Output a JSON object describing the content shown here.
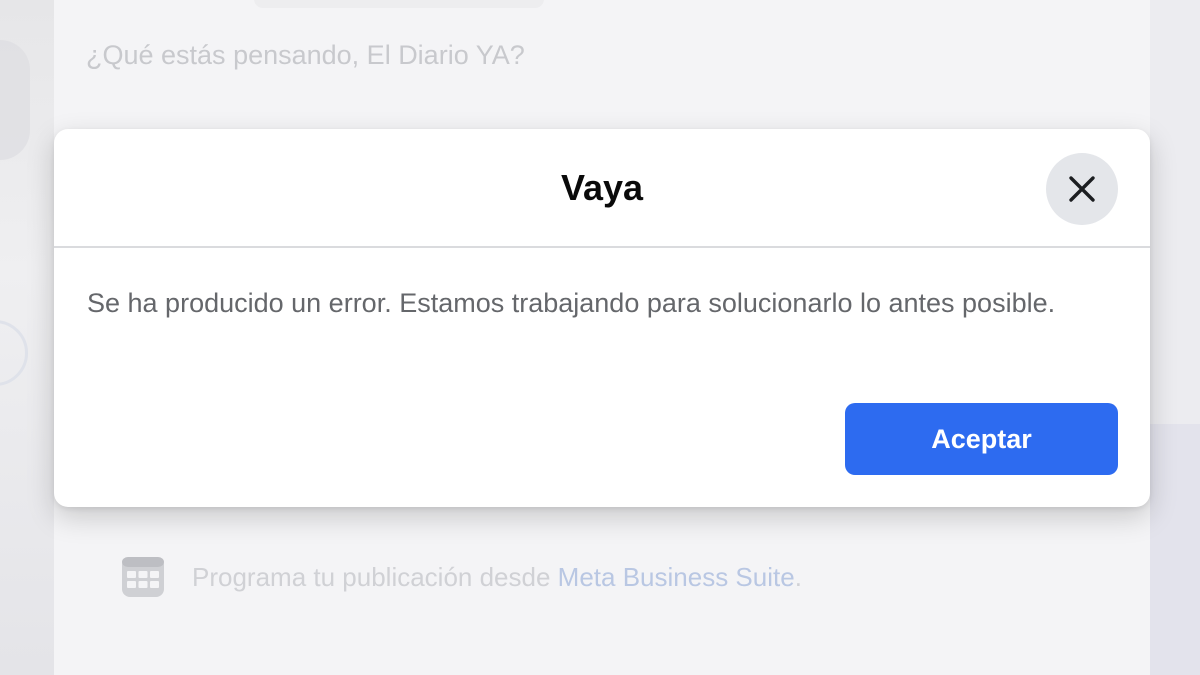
{
  "background": {
    "composer_placeholder": "¿Qué estás pensando, El Diario YA?",
    "schedule": {
      "icon": "calendar-icon",
      "text": "Programa tu publicación desde ",
      "link": "Meta Business Suite",
      "suffix": "."
    }
  },
  "dialog": {
    "title": "Vaya",
    "close_icon": "close-icon",
    "message": "Se ha producido un error. Estamos trabajando para solucionarlo lo antes posible.",
    "accept_label": "Aceptar"
  },
  "colors": {
    "accent": "#2d6bf0",
    "title_text": "#0a0a0a",
    "body_text": "#65676b",
    "close_button_bg": "#e4e6ea",
    "backdrop": "#f4f4f6"
  }
}
